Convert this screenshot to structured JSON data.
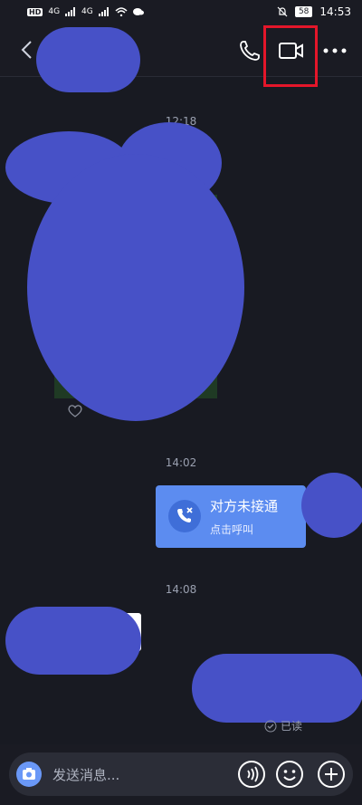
{
  "statusbar": {
    "network_badge": "HD",
    "signal_left": "4G",
    "signal_right": "4G",
    "battery": "58",
    "time": "14:53"
  },
  "chat": {
    "timestamps": [
      "12:18",
      "14:02",
      "14:08"
    ],
    "call_card": {
      "title": "对方未接通",
      "subtitle": "点击呼叫"
    },
    "read_status": "已读"
  },
  "input": {
    "placeholder": "发送消息..."
  },
  "icons": [
    "back-icon",
    "phone-icon",
    "video-call-icon",
    "more-icon",
    "missed-call-icon",
    "camera-icon",
    "voice-icon",
    "emoji-icon",
    "plus-icon"
  ],
  "colors": {
    "background": "#181a22",
    "accent": "#5c8cf0",
    "highlight_box": "#e4162a",
    "redaction": "#4751c7"
  }
}
